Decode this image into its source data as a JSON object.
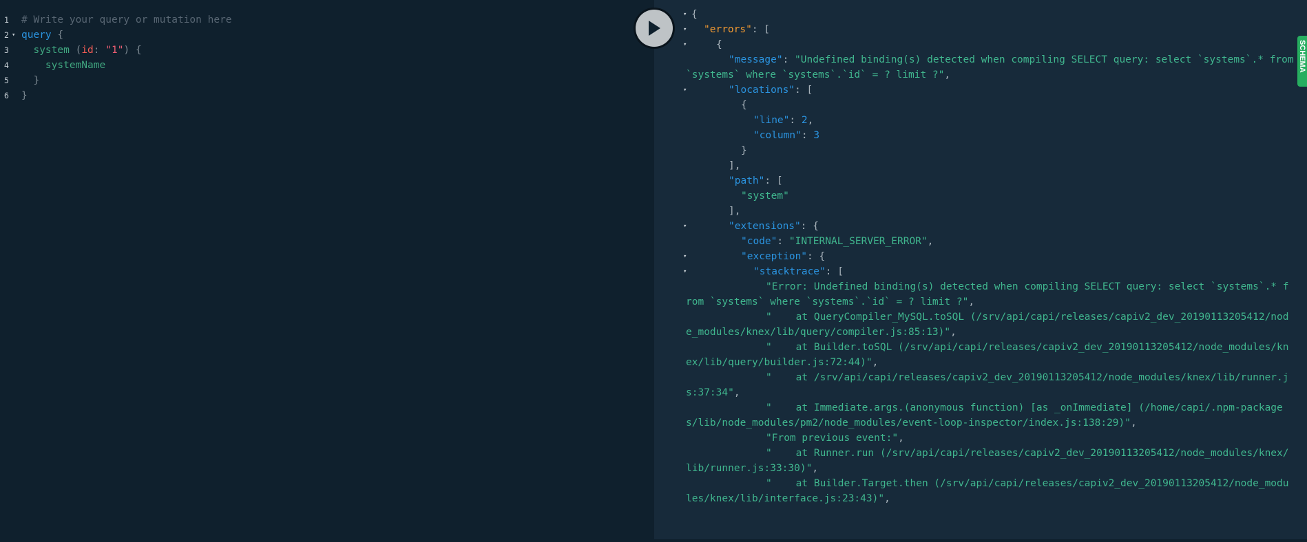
{
  "editor": {
    "line_numbers": [
      "1",
      "2",
      "3",
      "4",
      "5",
      "6"
    ],
    "comment": "# Write your query or mutation here",
    "query_keyword": "query",
    "open_brace": "{",
    "field_system": "system",
    "arg_name": "id",
    "arg_value": "\"1\"",
    "field_systemName": "systemName",
    "close_brace": "}"
  },
  "result_lines": [
    {
      "fold": true,
      "indent": 0,
      "parts": [
        {
          "t": "{",
          "c": "p"
        }
      ]
    },
    {
      "fold": true,
      "indent": 1,
      "parts": [
        {
          "t": "\"errors\"",
          "c": "k err"
        },
        {
          "t": ": [",
          "c": "p"
        }
      ]
    },
    {
      "fold": true,
      "indent": 2,
      "parts": [
        {
          "t": "{",
          "c": "p"
        }
      ]
    },
    {
      "fold": false,
      "indent": 3,
      "parts": [
        {
          "t": "\"message\"",
          "c": "k"
        },
        {
          "t": ": ",
          "c": "p"
        },
        {
          "t": "\"Undefined binding(s) detected when compiling SELECT query: select `systems`.* from `systems` where `systems`.`id` = ? limit ?\"",
          "c": "s"
        },
        {
          "t": ",",
          "c": "p"
        }
      ]
    },
    {
      "fold": true,
      "indent": 3,
      "parts": [
        {
          "t": "\"locations\"",
          "c": "k"
        },
        {
          "t": ": [",
          "c": "p"
        }
      ]
    },
    {
      "fold": false,
      "indent": 4,
      "parts": [
        {
          "t": "{",
          "c": "p"
        }
      ]
    },
    {
      "fold": false,
      "indent": 5,
      "parts": [
        {
          "t": "\"line\"",
          "c": "k"
        },
        {
          "t": ": ",
          "c": "p"
        },
        {
          "t": "2",
          "c": "n"
        },
        {
          "t": ",",
          "c": "p"
        }
      ]
    },
    {
      "fold": false,
      "indent": 5,
      "parts": [
        {
          "t": "\"column\"",
          "c": "k"
        },
        {
          "t": ": ",
          "c": "p"
        },
        {
          "t": "3",
          "c": "n"
        }
      ]
    },
    {
      "fold": false,
      "indent": 4,
      "parts": [
        {
          "t": "}",
          "c": "p"
        }
      ]
    },
    {
      "fold": false,
      "indent": 3,
      "parts": [
        {
          "t": "],",
          "c": "p"
        }
      ]
    },
    {
      "fold": false,
      "indent": 3,
      "parts": [
        {
          "t": "\"path\"",
          "c": "k"
        },
        {
          "t": ": [",
          "c": "p"
        }
      ]
    },
    {
      "fold": false,
      "indent": 4,
      "parts": [
        {
          "t": "\"system\"",
          "c": "s"
        }
      ]
    },
    {
      "fold": false,
      "indent": 3,
      "parts": [
        {
          "t": "],",
          "c": "p"
        }
      ]
    },
    {
      "fold": true,
      "indent": 3,
      "parts": [
        {
          "t": "\"extensions\"",
          "c": "k"
        },
        {
          "t": ": {",
          "c": "p"
        }
      ]
    },
    {
      "fold": false,
      "indent": 4,
      "parts": [
        {
          "t": "\"code\"",
          "c": "k"
        },
        {
          "t": ": ",
          "c": "p"
        },
        {
          "t": "\"INTERNAL_SERVER_ERROR\"",
          "c": "s"
        },
        {
          "t": ",",
          "c": "p"
        }
      ]
    },
    {
      "fold": true,
      "indent": 4,
      "parts": [
        {
          "t": "\"exception\"",
          "c": "k"
        },
        {
          "t": ": {",
          "c": "p"
        }
      ]
    },
    {
      "fold": true,
      "indent": 5,
      "parts": [
        {
          "t": "\"stacktrace\"",
          "c": "k"
        },
        {
          "t": ": [",
          "c": "p"
        }
      ]
    },
    {
      "fold": false,
      "indent": 6,
      "parts": [
        {
          "t": "\"Error: Undefined binding(s) detected when compiling SELECT query: select `systems`.* from `systems` where `systems`.`id` = ? limit ?\"",
          "c": "s"
        },
        {
          "t": ",",
          "c": "p"
        }
      ]
    },
    {
      "fold": false,
      "indent": 6,
      "parts": [
        {
          "t": "\"    at QueryCompiler_MySQL.toSQL (/srv/api/capi/releases/capiv2_dev_20190113205412/node_modules/knex/lib/query/compiler.js:85:13)\"",
          "c": "s"
        },
        {
          "t": ",",
          "c": "p"
        }
      ]
    },
    {
      "fold": false,
      "indent": 6,
      "parts": [
        {
          "t": "\"    at Builder.toSQL (/srv/api/capi/releases/capiv2_dev_20190113205412/node_modules/knex/lib/query/builder.js:72:44)\"",
          "c": "s"
        },
        {
          "t": ",",
          "c": "p"
        }
      ]
    },
    {
      "fold": false,
      "indent": 6,
      "parts": [
        {
          "t": "\"    at /srv/api/capi/releases/capiv2_dev_20190113205412/node_modules/knex/lib/runner.js:37:34\"",
          "c": "s"
        },
        {
          "t": ",",
          "c": "p"
        }
      ]
    },
    {
      "fold": false,
      "indent": 6,
      "parts": [
        {
          "t": "\"    at Immediate.args.(anonymous function) [as _onImmediate] (/home/capi/.npm-packages/lib/node_modules/pm2/node_modules/event-loop-inspector/index.js:138:29)\"",
          "c": "s"
        },
        {
          "t": ",",
          "c": "p"
        }
      ]
    },
    {
      "fold": false,
      "indent": 6,
      "parts": [
        {
          "t": "\"From previous event:\"",
          "c": "s"
        },
        {
          "t": ",",
          "c": "p"
        }
      ]
    },
    {
      "fold": false,
      "indent": 6,
      "parts": [
        {
          "t": "\"    at Runner.run (/srv/api/capi/releases/capiv2_dev_20190113205412/node_modules/knex/lib/runner.js:33:30)\"",
          "c": "s"
        },
        {
          "t": ",",
          "c": "p"
        }
      ]
    },
    {
      "fold": false,
      "indent": 6,
      "parts": [
        {
          "t": "\"    at Builder.Target.then (/srv/api/capi/releases/capiv2_dev_20190113205412/node_modules/knex/lib/interface.js:23:43)\"",
          "c": "s"
        },
        {
          "t": ",",
          "c": "p"
        }
      ]
    }
  ],
  "icons": {
    "play": "play-icon",
    "fold": "fold-arrow-icon"
  },
  "schema_tab_label": "SCHEMA",
  "colors": {
    "editor_bg": "#0f202d",
    "results_bg": "#172a3a",
    "keyword": "#2b94e0",
    "string": "#40b68e",
    "errors_key": "#f39a32",
    "schema_tab": "#27ae60"
  }
}
